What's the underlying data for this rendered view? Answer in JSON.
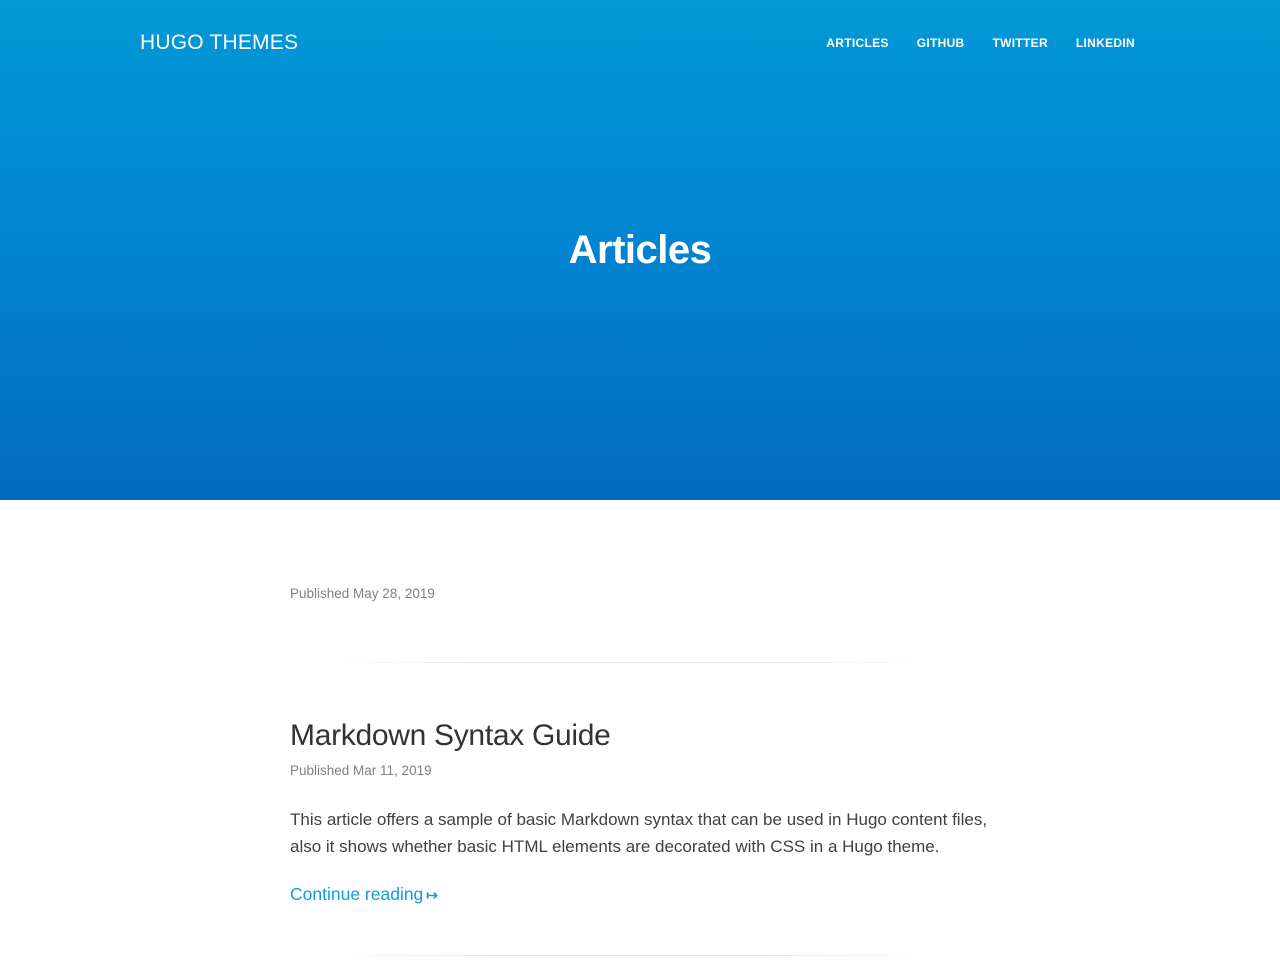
{
  "header": {
    "brand": "HUGO THEMES",
    "nav": [
      {
        "label": "ARTICLES"
      },
      {
        "label": "GITHUB"
      },
      {
        "label": "TWITTER"
      },
      {
        "label": "LINKEDIN"
      }
    ]
  },
  "hero": {
    "title": "Articles"
  },
  "articles": [
    {
      "published": "Published May 28, 2019"
    },
    {
      "title": "Markdown Syntax Guide",
      "published": "Published Mar 11, 2019",
      "excerpt": "This article offers a sample of basic Markdown syntax that can be used in Hugo content files, also it shows whether basic HTML elements are decorated with CSS in a Hugo theme.",
      "continue_label": "Continue reading",
      "continue_arrow": "↦"
    }
  ],
  "colors": {
    "hero_top": "#0299d6",
    "hero_bottom": "#016bc3",
    "link": "#0f9ed8"
  }
}
